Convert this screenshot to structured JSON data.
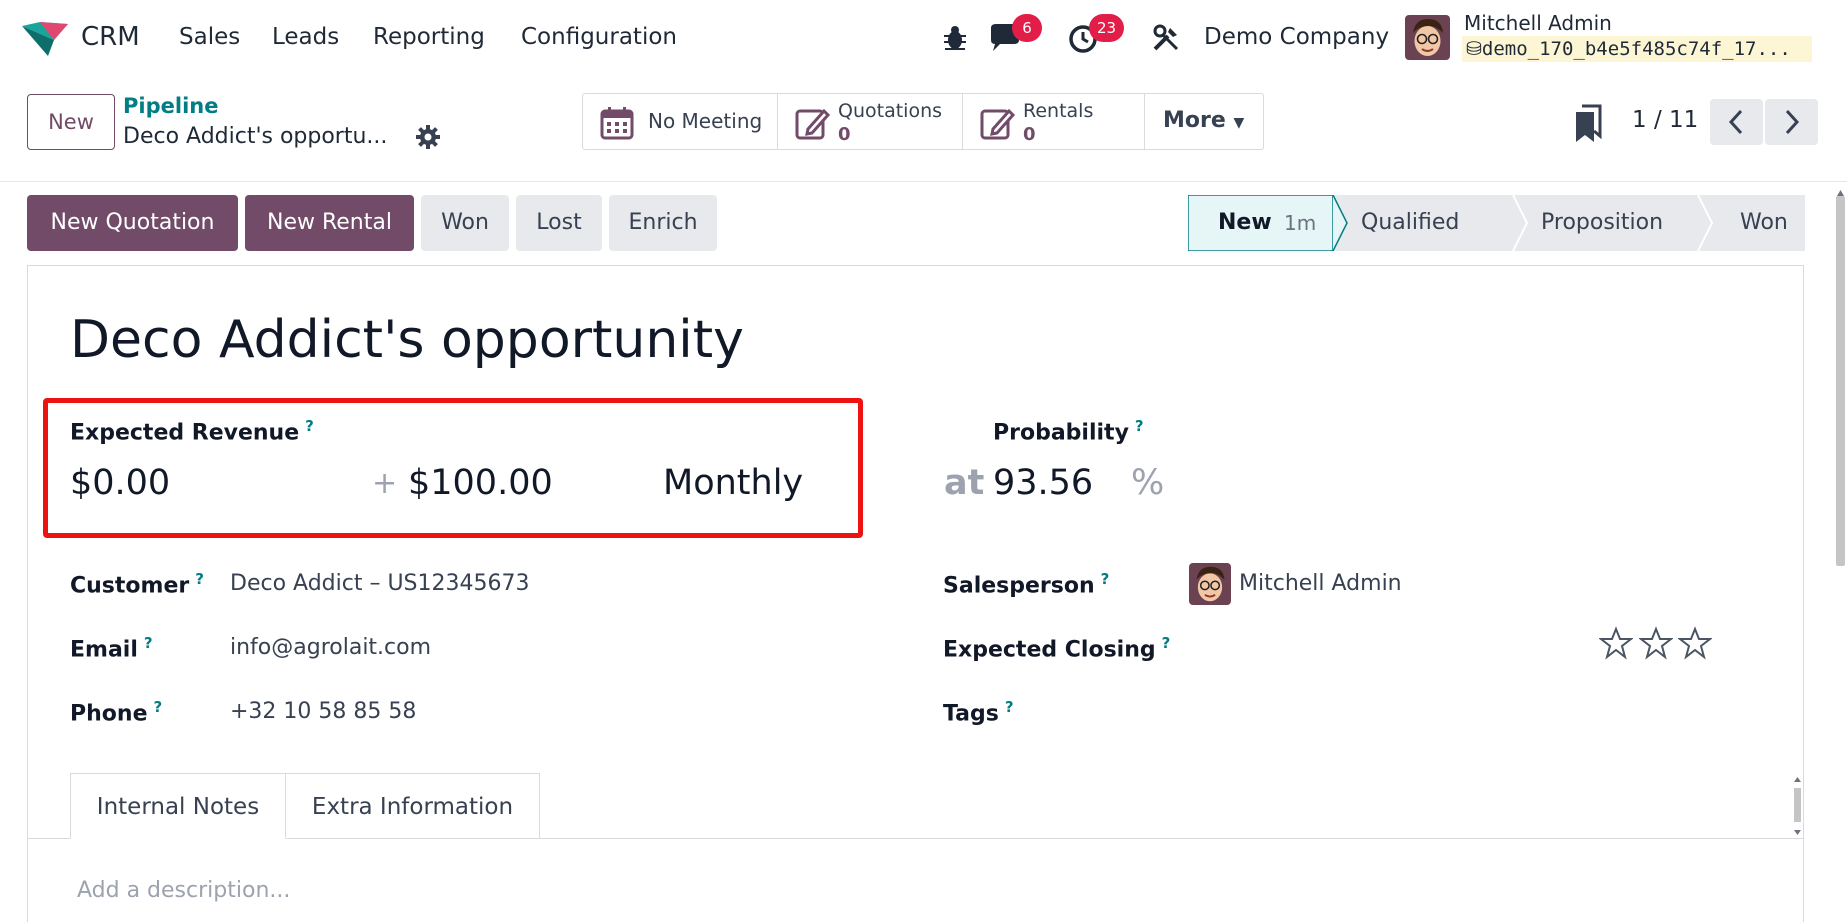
{
  "nav": {
    "app_name": "CRM",
    "menus": [
      "Sales",
      "Leads",
      "Reporting",
      "Configuration"
    ],
    "messages_count": "6",
    "activities_count": "23",
    "company": "Demo Company",
    "user_name": "Mitchell Admin",
    "database": "demo_170_b4e5f485c74f_17..."
  },
  "control_panel": {
    "new_label": "New",
    "breadcrumb_parent": "Pipeline",
    "breadcrumb_current": "Deco Addict's opportu...",
    "smart_buttons": {
      "meeting": "No Meeting",
      "quotations_label": "Quotations",
      "quotations_count": "0",
      "rentals_label": "Rentals",
      "rentals_count": "0",
      "more": "More"
    },
    "pager": "1 / 11"
  },
  "statusbar": {
    "buttons": [
      "New Quotation",
      "New Rental",
      "Won",
      "Lost",
      "Enrich"
    ],
    "stages": [
      {
        "label": "New",
        "duration": "1m",
        "active": true
      },
      {
        "label": "Qualified",
        "active": false
      },
      {
        "label": "Proposition",
        "active": false
      },
      {
        "label": "Won",
        "active": false
      }
    ]
  },
  "form": {
    "title": "Deco Addict's opportunity",
    "expected_revenue_label": "Expected Revenue",
    "expected_revenue": "$0.00",
    "plus": "+",
    "recurring_revenue": "$100.00",
    "recurring_plan": "Monthly",
    "probability_label": "Probability",
    "at": "at",
    "probability": "93.56",
    "percent": "%",
    "customer_label": "Customer",
    "customer": "Deco Addict – US12345673",
    "email_label": "Email",
    "email": "info@agrolait.com",
    "phone_label": "Phone",
    "phone": "+32 10 58 85 58",
    "salesperson_label": "Salesperson",
    "salesperson": "Mitchell Admin",
    "expected_closing_label": "Expected Closing",
    "priority_stars": 0,
    "tags_label": "Tags",
    "help_mark": "?"
  },
  "tabs": [
    "Internal Notes",
    "Extra Information"
  ],
  "description_placeholder": "Add a description...",
  "colors": {
    "primary": "#714b67",
    "teal": "#017e84",
    "highlight": "#ee1313",
    "badge": "#e11d48"
  }
}
